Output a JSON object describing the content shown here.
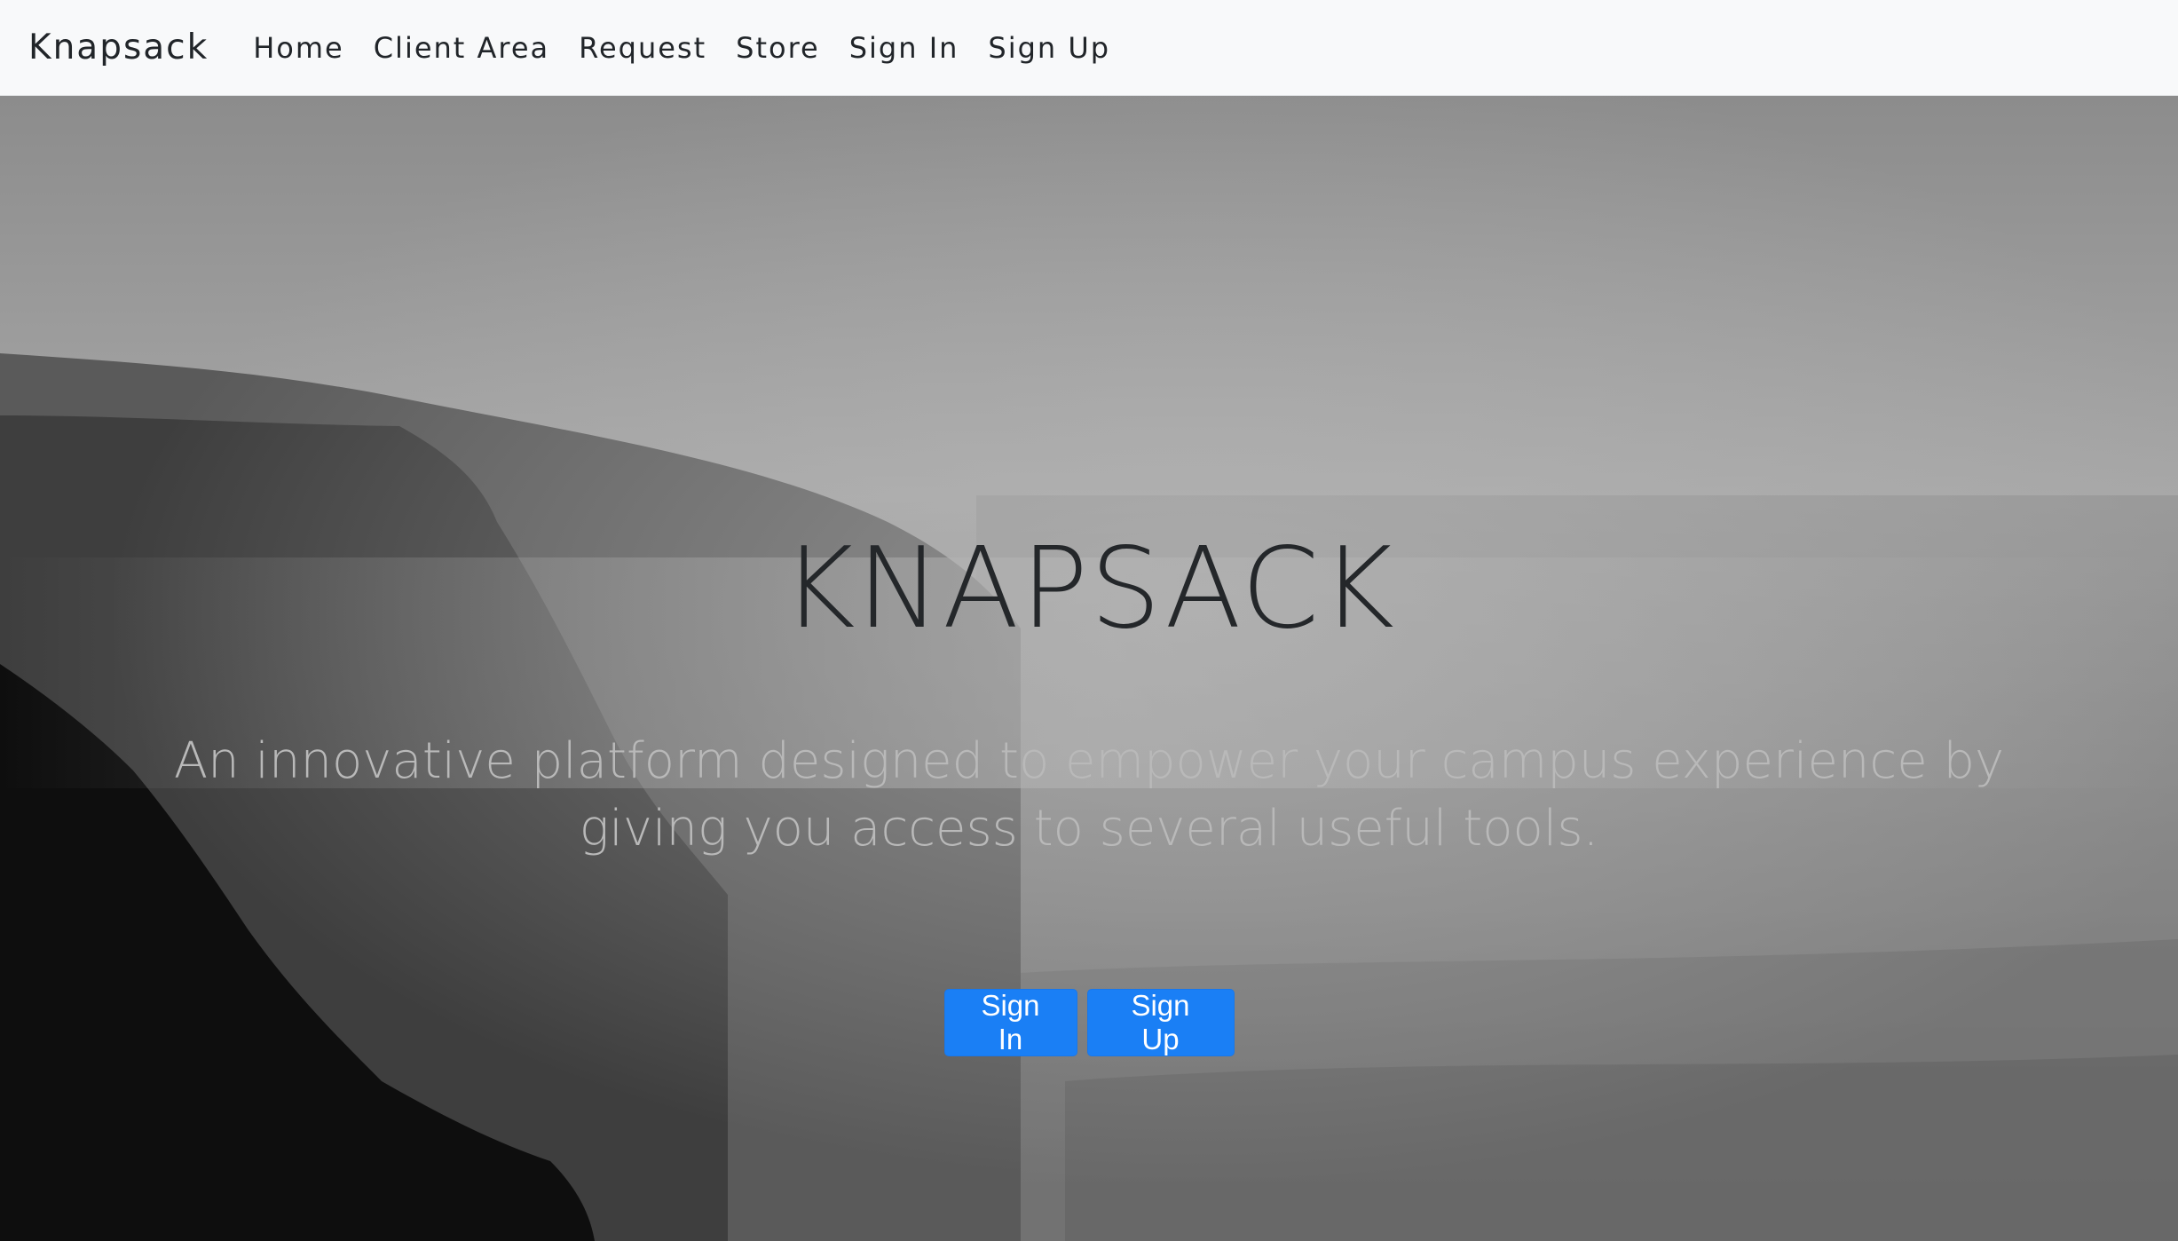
{
  "navbar": {
    "brand": "Knapsack",
    "links": [
      {
        "label": "Home"
      },
      {
        "label": "Client Area"
      },
      {
        "label": "Request"
      },
      {
        "label": "Store"
      },
      {
        "label": "Sign In"
      },
      {
        "label": "Sign Up"
      }
    ]
  },
  "hero": {
    "title": "KNAPSACK",
    "subtitle": "An innovative platform designed to empower your campus experience by giving you access to several useful tools.",
    "buttons": {
      "sign_in": "Sign In",
      "sign_up": "Sign Up"
    },
    "background_image": "grayscale coastal cliffs over misty sea"
  },
  "colors": {
    "navbar_bg": "#f8f9fa",
    "primary_button": "#1a7ff5",
    "title_text": "#24272a",
    "subtitle_text": "#b9b9b9"
  }
}
